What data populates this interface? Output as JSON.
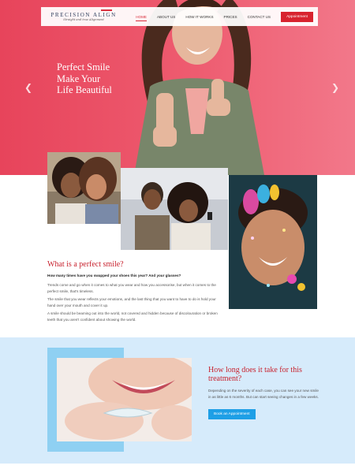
{
  "brand": {
    "name": "PRECISION ALIGN",
    "tagline": "Straight and true Alignment"
  },
  "nav": {
    "items": [
      "HOME",
      "ABOUT US",
      "HOW IT WORKS",
      "PRICES",
      "CONTACT US"
    ],
    "active": "HOME",
    "appointment_label": "Appointment"
  },
  "hero": {
    "lines": [
      "Perfect Smile",
      "Make Your",
      "Life Beautiful"
    ],
    "prev_icon": "chevron-left-icon",
    "next_icon": "chevron-right-icon"
  },
  "perfect": {
    "title": "What is a perfect smile?",
    "question": "How many times have you swapped your shoes this year? And your glasses?",
    "paragraphs": [
      "Trends come and go when it comes to what you wear and how you accessorise, but when it comes to the perfect smile, that's timeless.",
      "The smile that you wear reflects your emotions, and the last thing that you want to have to do is hold your hand over your mouth and cover it up.",
      "A smile should be beaming out into the world, not covered and hidden because of discolouration or broken teeth that you aren't confident about showing the world."
    ]
  },
  "treatment": {
    "title": "How long does it take for this treatment?",
    "text": "Depending on the severity of each case, you can see your new smile in as little as 6 months. But can start seeing changes in a few weeks.",
    "button_label": "Book an Appointment"
  },
  "colors": {
    "accent": "#d8232f",
    "hero": "#e7445b",
    "blue_bg": "#d6ebfb",
    "button_blue": "#1e9fe6"
  }
}
